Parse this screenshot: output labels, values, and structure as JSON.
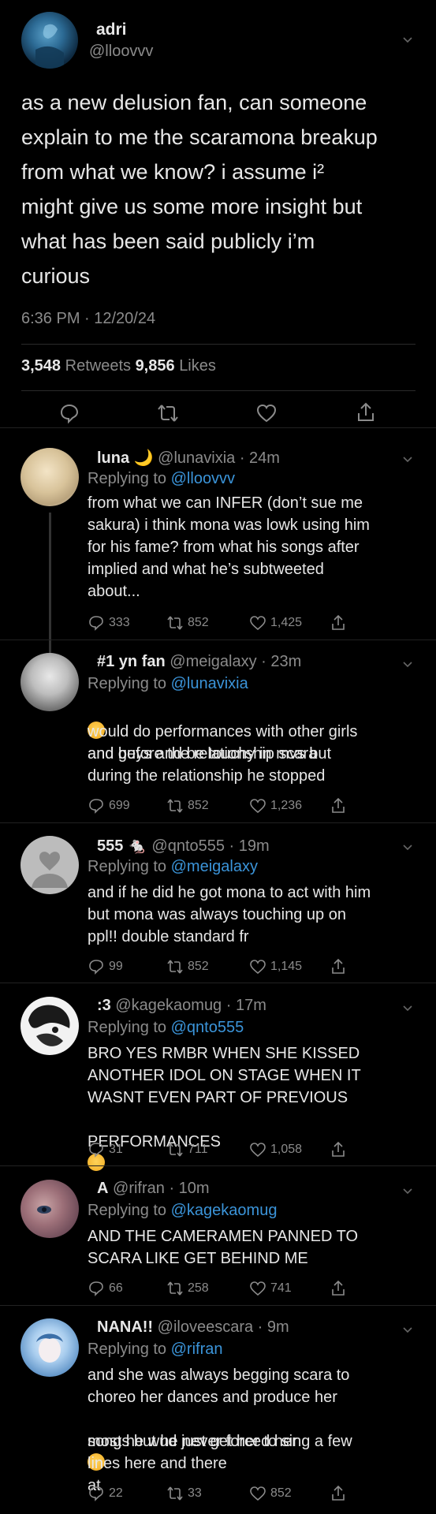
{
  "main_tweet": {
    "name": "adri",
    "handle": "@lloovvv",
    "text": "as a new delusion fan, can someone\nexplain to me the scaramona breakup\nfrom what we know? i assume i²\nmight give us some more insight but\nwhat has been said publicly i’m\ncurious",
    "timestamp": "6:36 PM · 12/20/24",
    "retweets_count": "3,548",
    "retweets_label": "Retweets",
    "likes_count": "9,856",
    "likes_label": "Likes"
  },
  "replies": [
    {
      "name": "luna 🌙",
      "handle": "@lunavixia · 24m",
      "replying_label": "Replying to",
      "replying_to": "@lloovvv",
      "text": "from what we can INFER (don’t sue me\nsakura) i think mona was lowk using him\nfor his fame? from what his songs after\nimplied and what he’s subtweeted\nabout...",
      "comments": "333",
      "retweets": "852",
      "likes": "1,425"
    },
    {
      "name": "#1 yn fan",
      "handle": "@meigalaxy · 23m",
      "replying_label": "Replying to",
      "replying_to": "@lunavixia",
      "text_first": "and before the relationship scara",
      "text": "would do performances with other girls\nand guys and be touchy in mvs but\nduring the relationship he stopped",
      "comments": "699",
      "retweets": "852",
      "likes": "1,236"
    },
    {
      "name": "555 🐁",
      "handle": "@qnto555 · 19m",
      "replying_label": "Replying to",
      "replying_to": "@meigalaxy",
      "text": "and if he did he got mona to act with him\nbut mona was always touching up on\nppl!! double standard fr",
      "comments": "99",
      "retweets": "852",
      "likes": "1,145"
    },
    {
      "name": ":3",
      "handle": "@kagekaomug · 17m",
      "replying_label": "Replying to",
      "replying_to": "@qnto555",
      "text": "BRO YES RMBR WHEN SHE KISSED\nANOTHER IDOL ON STAGE WHEN IT\nWASNT EVEN PART OF PREVIOUS",
      "text_last": "PERFORMANCES",
      "comments": "31",
      "retweets": "711",
      "likes": "1,058"
    },
    {
      "name": "A",
      "handle": "@rifran · 10m",
      "replying_label": "Replying to",
      "replying_to": "@kagekaomug",
      "text": "AND THE CAMERAMEN PANNED TO\nSCARA LIKE GET BEHIND ME",
      "comments": "66",
      "retweets": "258",
      "likes": "741"
    },
    {
      "name": "NANA!!",
      "handle": "@iloveescara · 9m",
      "replying_label": "Replying to",
      "replying_to": "@rifran",
      "text": "and she was always begging scara to\nchoreo her dances and produce her",
      "text_mid_a": "songs but he never forced her",
      "text_mid_b": "at",
      "text_end": "most he wud just get her to sing a few\nlines here and there",
      "comments": "22",
      "retweets": "33",
      "likes": "852"
    }
  ],
  "colors": {
    "background": "#000000",
    "link": "#3b94d9",
    "muted": "#8b8b8b",
    "text": "#e7e7e7"
  },
  "icons": [
    "chevron-down-icon",
    "reply-icon",
    "retweet-icon",
    "like-icon",
    "share-icon",
    "crying-emoji"
  ]
}
